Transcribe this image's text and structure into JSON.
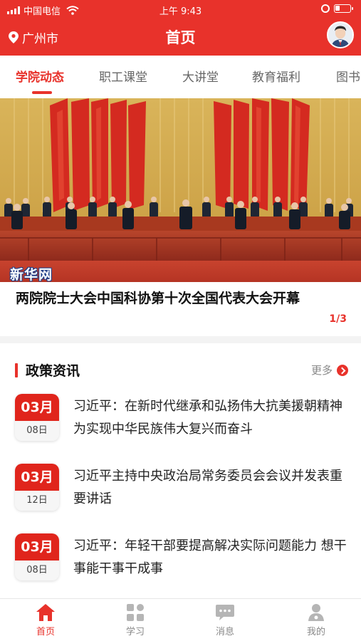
{
  "status_bar": {
    "carrier": "中国电信",
    "time": "上午 9:43"
  },
  "header": {
    "location": "广州市",
    "title": "首页"
  },
  "tabs": [
    {
      "label": "学院动态",
      "active": true
    },
    {
      "label": "职工课堂",
      "active": false
    },
    {
      "label": "大讲堂",
      "active": false
    },
    {
      "label": "教育福利",
      "active": false
    },
    {
      "label": "图书",
      "active": false
    }
  ],
  "banner": {
    "watermark": "新华网",
    "caption": "两院院士大会中国科协第十次全国代表大会开幕",
    "counter": "1/3"
  },
  "policy": {
    "title": "政策资讯",
    "more_label": "更多",
    "items": [
      {
        "month": "03月",
        "day": "08日",
        "title": "习近平：在新时代继承和弘扬伟大抗美援朝精神 为实现中华民族伟大复兴而奋斗"
      },
      {
        "month": "03月",
        "day": "12日",
        "title": "习近平主持中央政治局常务委员会会议并发表重要讲话"
      },
      {
        "month": "03月",
        "day": "08日",
        "title": "习近平：年轻干部要提高解决实际问题能力 想干事能干事干成事"
      }
    ]
  },
  "bottom_nav": [
    {
      "label": "首页",
      "icon": "home-icon",
      "active": true
    },
    {
      "label": "学习",
      "icon": "grid-icon",
      "active": false
    },
    {
      "label": "消息",
      "icon": "message-icon",
      "active": false
    },
    {
      "label": "我的",
      "icon": "user-icon",
      "active": false
    }
  ],
  "colors": {
    "brand": "#e8322b",
    "badge_month": "#e0251c"
  }
}
